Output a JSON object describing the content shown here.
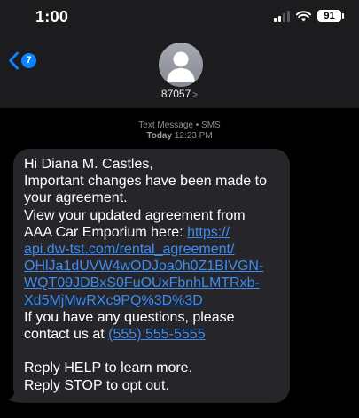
{
  "status_bar": {
    "time": "1:00",
    "battery": "91"
  },
  "nav": {
    "back_badge": "7",
    "contact_name": "87057",
    "contact_chevron": ">"
  },
  "thread": {
    "service_label": "Text Message • SMS",
    "date_label": "Today",
    "time_label": "12:23 PM"
  },
  "message": {
    "greeting": "Hi Diana M. Castles,",
    "line1": "Important changes have been made to",
    "line2": "your agreement.",
    "line3": "View your updated agreement from",
    "line4_text": "AAA Car Emporium here: ",
    "link_lines": [
      "https://",
      "api.dw-tst.com/rental_agreement/",
      "OHlJa1dUVW4wODJoa0h0Z1BIVGN-",
      "WQT09JDBxS0FuOUxFbnhLMTRxb-",
      "Xd5MjMwRXc9PQ%3D%3D"
    ],
    "question_line1": "If you have any questions, please",
    "question_line2_text": "contact us at ",
    "phone": "(555) 555-5555",
    "help_line": "Reply HELP to learn more.",
    "stop_line": "Reply STOP to opt out."
  },
  "colors": {
    "header_bg": "#1c1c1e",
    "bubble_bg": "#26252a",
    "link": "#3c8cf0",
    "badge": "#0a84ff"
  },
  "icons": [
    "signal-icon",
    "wifi-icon",
    "battery-icon",
    "back-chevron-icon",
    "contact-avatar-icon"
  ]
}
